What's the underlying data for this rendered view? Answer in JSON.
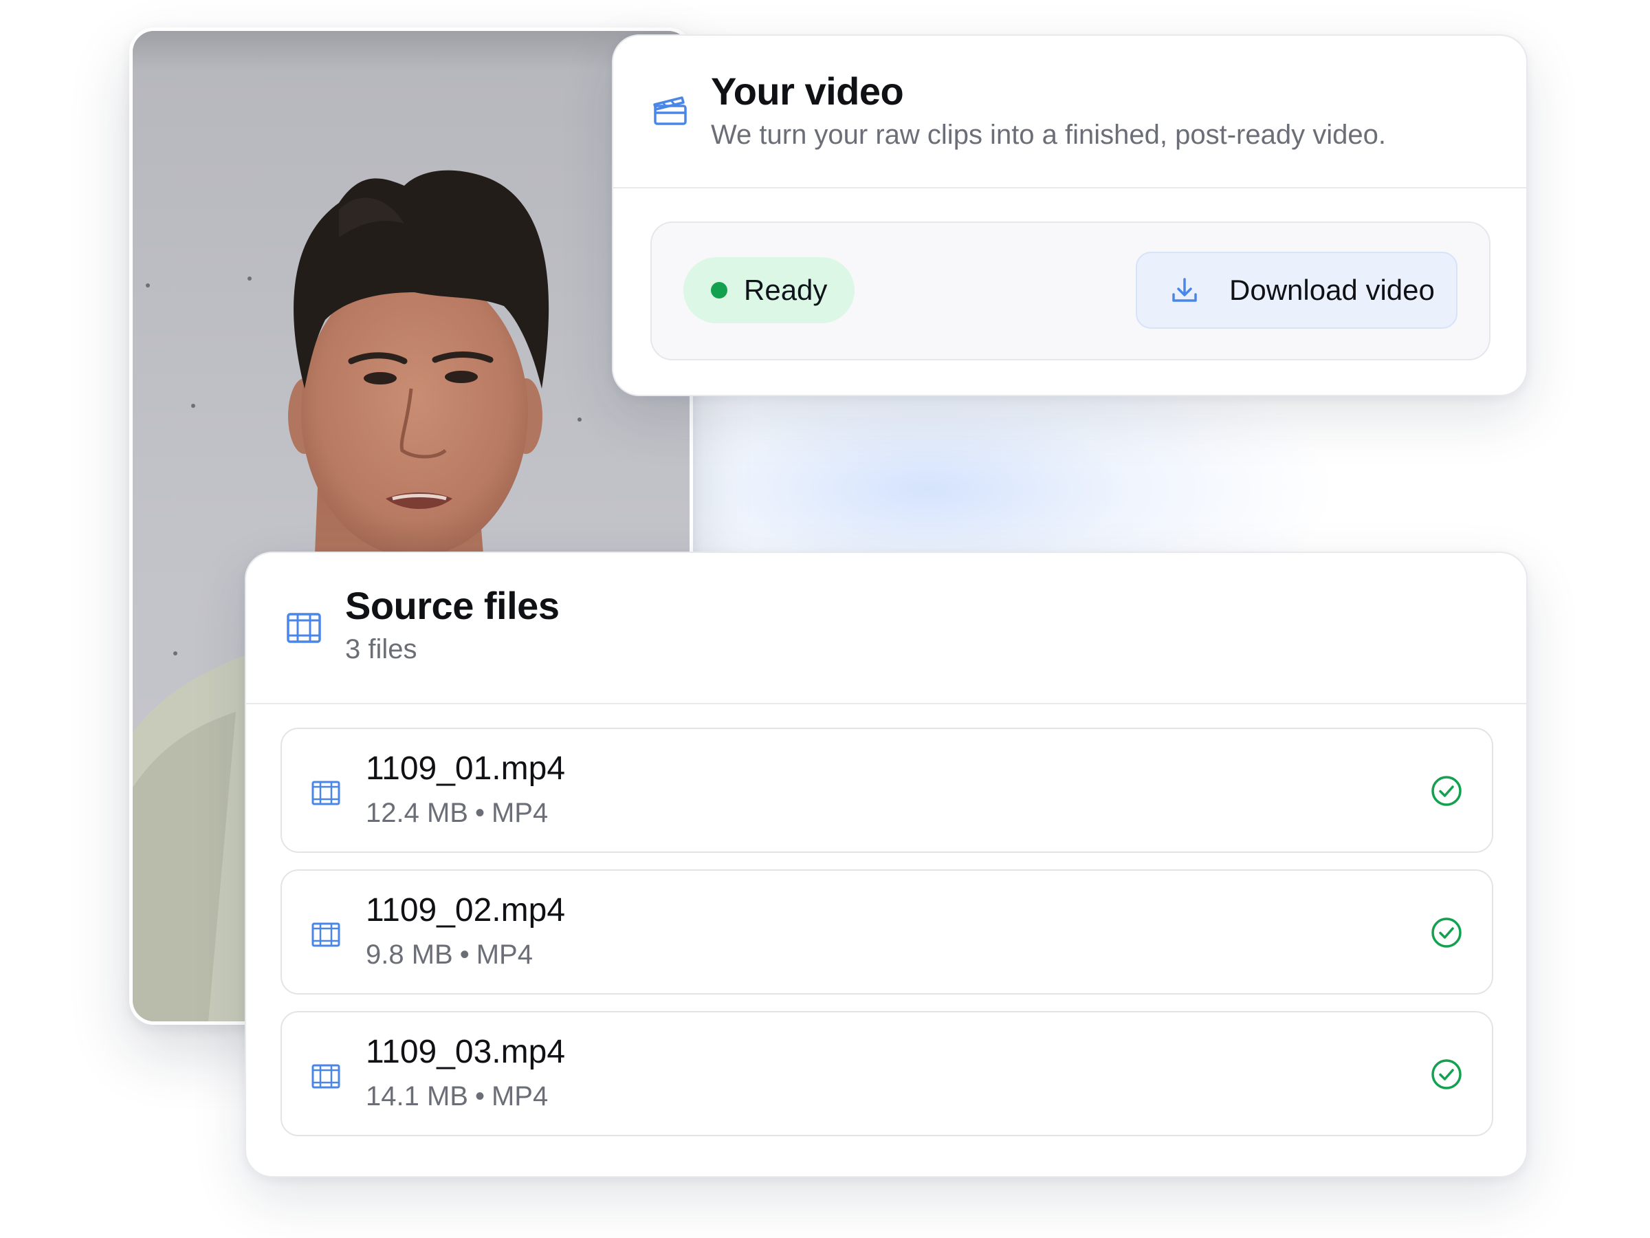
{
  "video_card": {
    "title": "Your video",
    "subtitle": "We turn your raw clips into a finished, post-ready video.",
    "icon": "clapperboard-icon",
    "status": "Ready",
    "status_color": "#13a150",
    "download_label": "Download video",
    "download_icon": "download-icon"
  },
  "source_files": {
    "title": "Source files",
    "count": "3 files",
    "icon": "film-icon",
    "files": [
      {
        "name": "1109_01.mp4",
        "size": "12.4 MB",
        "separator": "•",
        "format": "MP4",
        "status_icon": "check-circle-icon"
      },
      {
        "name": "1109_02.mp4",
        "size": "9.8 MB",
        "separator": "•",
        "format": "MP4",
        "status_icon": "check-circle-icon"
      },
      {
        "name": "1109_03.mp4",
        "size": "14.1 MB",
        "separator": "•",
        "format": "MP4",
        "status_icon": "check-circle-icon"
      }
    ]
  },
  "colors": {
    "accent": "#4a86e8",
    "success": "#13a150",
    "badge_bg": "#dcf7e6",
    "button_bg": "#eaf1fd"
  }
}
